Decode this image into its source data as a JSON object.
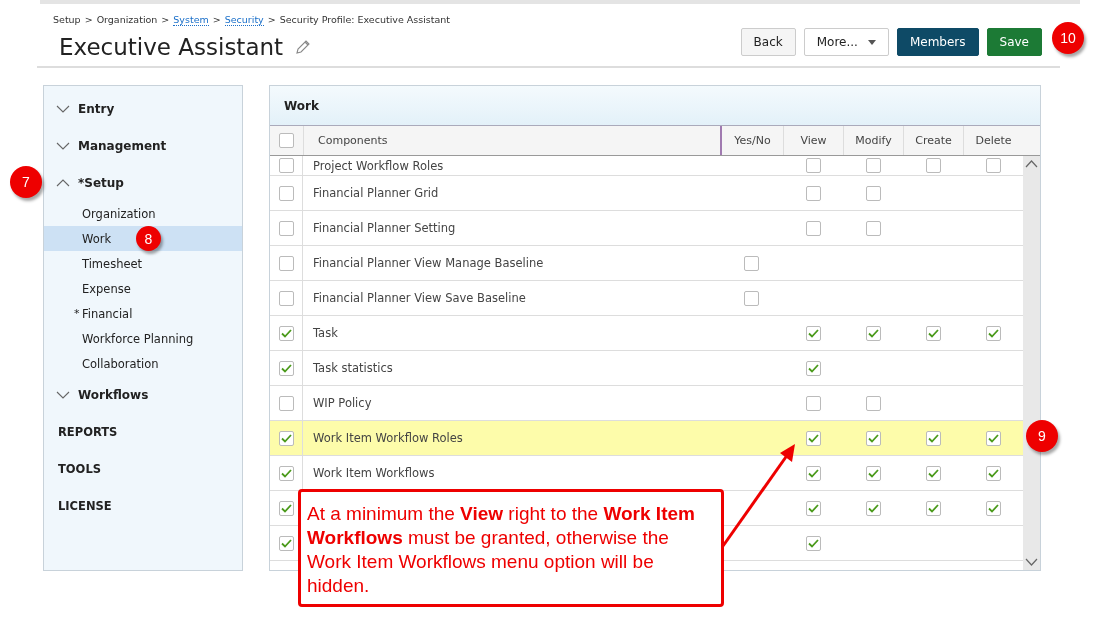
{
  "breadcrumb": [
    {
      "label": "Setup",
      "link": false
    },
    {
      "label": "Organization",
      "link": false
    },
    {
      "label": "System",
      "link": true
    },
    {
      "label": "Security",
      "link": true
    },
    {
      "label": "Security Profile: Executive Assistant",
      "link": false
    }
  ],
  "breadcrumb_separator": ">",
  "title": "Executive Assistant",
  "buttons": [
    {
      "label": "Back",
      "kind": "plain"
    },
    {
      "label": "More...",
      "kind": "dropdown"
    },
    {
      "label": "Members",
      "kind": "dark"
    },
    {
      "label": "Save",
      "kind": "primary"
    }
  ],
  "sidebar": {
    "items": [
      {
        "kind": "group",
        "label": "Entry",
        "expanded": false
      },
      {
        "kind": "group",
        "label": "Management",
        "expanded": false
      },
      {
        "kind": "group",
        "label": "Setup",
        "marker": "*",
        "expanded": true,
        "badge": "7",
        "children": [
          {
            "label": "Organization",
            "selected": false
          },
          {
            "label": "Work",
            "selected": true,
            "badge": "8"
          },
          {
            "label": "Timesheet",
            "selected": false
          },
          {
            "label": "Expense",
            "selected": false
          },
          {
            "label": "Financial",
            "marker": "*",
            "selected": false
          },
          {
            "label": "Workforce Planning",
            "selected": false
          },
          {
            "label": "Collaboration",
            "selected": false
          }
        ]
      },
      {
        "kind": "group",
        "label": "Workflows",
        "expanded": false
      },
      {
        "kind": "section",
        "label": "REPORTS"
      },
      {
        "kind": "section",
        "label": "TOOLS"
      },
      {
        "kind": "section",
        "label": "LICENSE"
      }
    ]
  },
  "panel": {
    "title": "Work",
    "all_checked": false,
    "columns": [
      "Components",
      "Yes/No",
      "View",
      "Modify",
      "Create",
      "Delete"
    ],
    "rows": [
      {
        "name": "Project Workflow Roles",
        "checked": false,
        "highlighted": false,
        "view": false,
        "modify": false,
        "create": false,
        "delete": false
      },
      {
        "name": "Financial Planner Grid",
        "checked": false,
        "highlighted": false,
        "view": false,
        "modify": false
      },
      {
        "name": "Financial Planner Setting",
        "checked": false,
        "highlighted": false,
        "view": false,
        "modify": false
      },
      {
        "name": "Financial Planner View Manage Baseline",
        "checked": false,
        "highlighted": false,
        "yes_no": false
      },
      {
        "name": "Financial Planner View Save Baseline",
        "checked": false,
        "highlighted": false,
        "yes_no": false
      },
      {
        "name": "Task",
        "checked": true,
        "highlighted": false,
        "view": true,
        "modify": true,
        "create": true,
        "delete": true
      },
      {
        "name": "Task statistics",
        "checked": true,
        "highlighted": false,
        "view": true
      },
      {
        "name": "WIP Policy",
        "checked": false,
        "highlighted": false,
        "view": false,
        "modify": false
      },
      {
        "name": "Work Item Workflow Roles",
        "checked": true,
        "highlighted": true,
        "view": true,
        "modify": true,
        "create": true,
        "delete": true
      },
      {
        "name": "Work Item Workflows",
        "checked": true,
        "highlighted": false,
        "view": true,
        "modify": true,
        "create": true,
        "delete": true
      },
      {
        "checked": true,
        "highlighted": false,
        "view": true,
        "modify": true,
        "create": true,
        "delete": true
      },
      {
        "checked": true,
        "highlighted": false,
        "view": true
      }
    ]
  },
  "annotations": {
    "steps": [
      "9",
      "10"
    ],
    "callout": "At a minimum the  **View** right to the **Work Item Workflows** must be granted, otherwise the Work Item Workflows menu option will be hidden."
  }
}
